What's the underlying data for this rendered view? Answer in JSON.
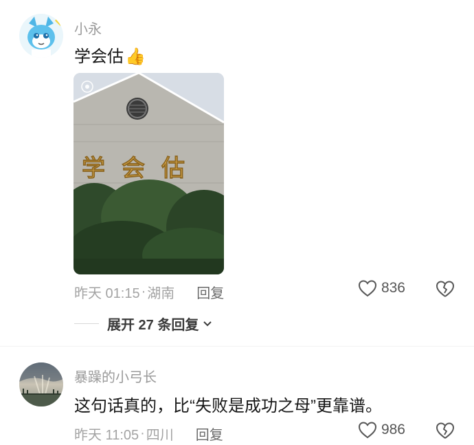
{
  "comments": [
    {
      "username": "小永",
      "text": "学会估",
      "emoji": "👍",
      "time": "昨天 01:15",
      "location": "湖南",
      "reply_label": "回复",
      "likes": "836",
      "image_sign": "学 会 估"
    },
    {
      "username": "暴躁的小弓长",
      "text": "这句话真的，比“失败是成功之母”更靠谱。",
      "time": "昨天 11:05",
      "location": "四川",
      "reply_label": "回复",
      "likes": "986"
    }
  ],
  "expand_replies": {
    "label": "展开 27 条回复"
  },
  "colors": {
    "meta": "#a3a3a3",
    "text": "#161616"
  }
}
